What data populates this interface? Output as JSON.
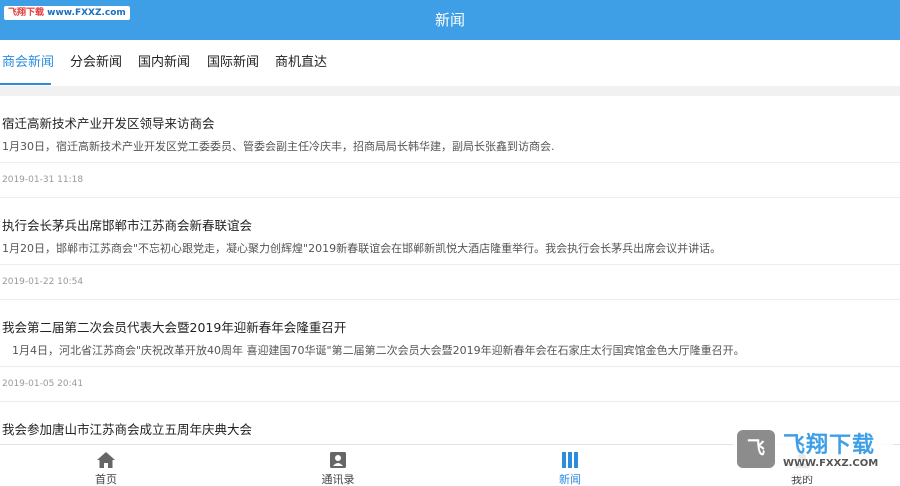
{
  "header": {
    "title": "新闻",
    "watermark_prefix": "飞翔下载",
    "watermark_url": "www.FXXZ.com"
  },
  "tabs": [
    {
      "label": "商会新闻",
      "active": true
    },
    {
      "label": "分会新闻",
      "active": false
    },
    {
      "label": "国内新闻",
      "active": false
    },
    {
      "label": "国际新闻",
      "active": false
    },
    {
      "label": "商机直达",
      "active": false
    }
  ],
  "news": [
    {
      "title": "宿迁高新技术产业开发区领导来访商会",
      "summary": "1月30日，宿迁高新技术产业开发区党工委委员、管委会副主任冷庆丰，招商局局长韩华建，副局长张鑫到访商会.",
      "date": "2019-01-31 11:18"
    },
    {
      "title": "执行会长茅兵出席邯郸市江苏商会新春联谊会",
      "summary": "1月20日，邯郸市江苏商会\"不忘初心跟党走，凝心聚力创辉煌\"2019新春联谊会在邯郸新凯悦大酒店隆重举行。我会执行会长茅兵出席会议并讲话。",
      "date": "2019-01-22 10:54"
    },
    {
      "title": "我会第二届第二次会员代表大会暨2019年迎新春年会隆重召开",
      "summary": "1月4日，河北省江苏商会\"庆祝改革开放40周年 喜迎建国70华诞\"第二届第二次会员大会暨2019年迎新春年会在石家庄太行国宾馆金色大厅隆重召开。",
      "date": "2019-01-05 20:41"
    },
    {
      "title": "我会参加唐山市江苏商会成立五周年庆典大会",
      "summary": "",
      "date": ""
    }
  ],
  "bottom_nav": [
    {
      "label": "首页",
      "icon": "home-icon",
      "active": false
    },
    {
      "label": "通讯录",
      "icon": "contacts-icon",
      "active": false
    },
    {
      "label": "新闻",
      "icon": "news-icon",
      "active": true
    },
    {
      "label": "我的",
      "icon": "profile-icon",
      "active": false
    }
  ],
  "watermark": {
    "name": "飞翔下载",
    "url": "WWW.FXXZ.COM",
    "logo_char": "飞"
  },
  "colors": {
    "primary": "#3e9ee6",
    "accent": "#2a8de0",
    "icon_gray": "#666666"
  }
}
